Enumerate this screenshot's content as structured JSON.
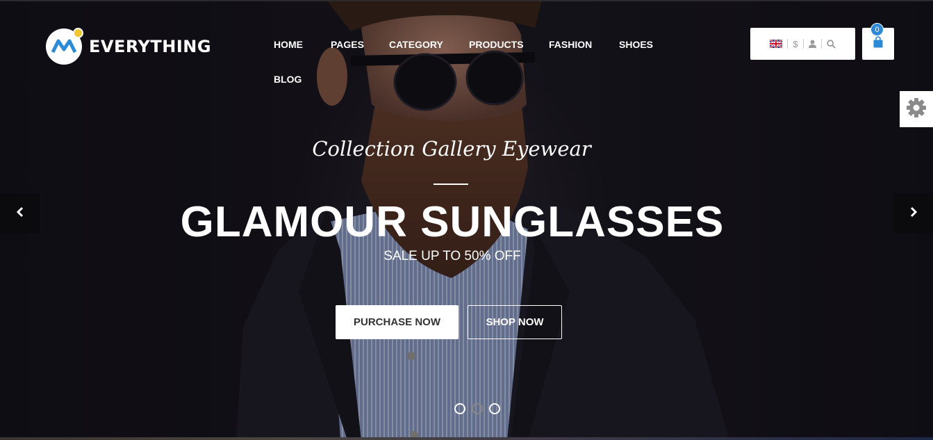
{
  "brand": {
    "name": "EVERYTHING"
  },
  "nav": {
    "items": [
      {
        "label": "HOME"
      },
      {
        "label": "PAGES"
      },
      {
        "label": "CATEGORY"
      },
      {
        "label": "PRODUCTS"
      },
      {
        "label": "FASHION"
      },
      {
        "label": "SHOES"
      },
      {
        "label": "BLOG"
      }
    ]
  },
  "tools": {
    "currency": "$",
    "icons": [
      "uk-flag-icon",
      "dollar-icon",
      "user-icon",
      "search-icon"
    ]
  },
  "cart": {
    "count": "0",
    "icon": "shopping-bag-icon"
  },
  "settings": {
    "icon": "gear-icon"
  },
  "slider": {
    "subtitle": "Collection Gallery Eyewear",
    "title": "GLAMOUR SUNGLASSES",
    "tagline": "SALE UP TO 50% OFF",
    "primary_button": "PURCHASE NOW",
    "secondary_button": "SHOP NOW",
    "slide_count": 3,
    "active_slide": 1
  },
  "colors": {
    "accent": "#2d8ad6",
    "logo_yellow": "#f3c531",
    "logo_blue": "#2d8ad6"
  }
}
